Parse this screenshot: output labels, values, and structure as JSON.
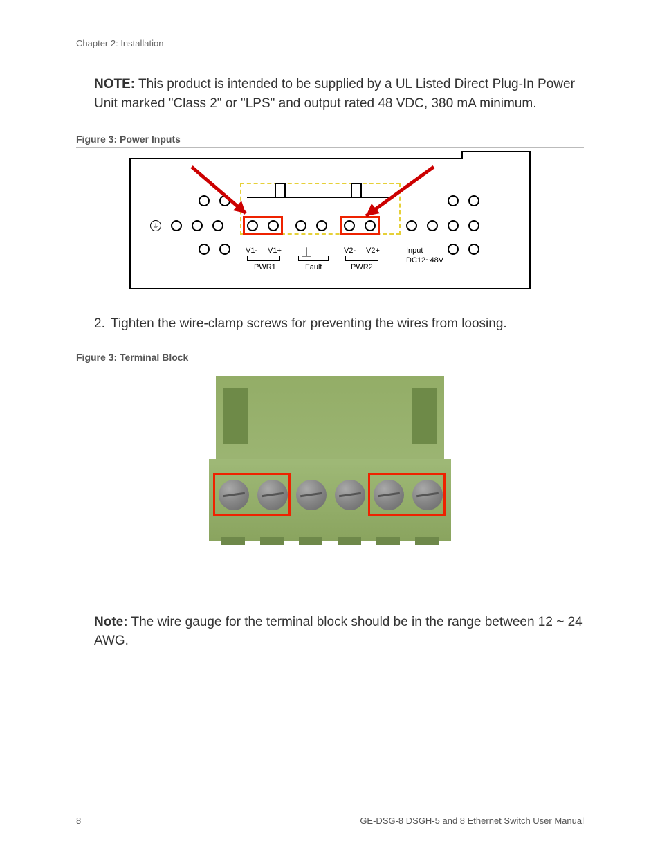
{
  "chapter_header": "Chapter 2: Installation",
  "note1_bold": "NOTE:",
  "note1_text": " This product is intended to be supplied by a UL Listed Direct Plug-In Power Unit marked \"Class 2\" or \"LPS\" and output rated 48 VDC, 380 mA minimum.",
  "figure3a_caption": "Figure 3: Power Inputs",
  "diagram1": {
    "v1_minus": "V1-",
    "v1_plus": "V1+",
    "v2_minus": "V2-",
    "v2_plus": "V2+",
    "input": "Input",
    "dc_range": "DC12~48V",
    "pwr1": "PWR1",
    "fault": "Fault",
    "pwr2": "PWR2",
    "ground_glyph": "⏚"
  },
  "step2_num": "2.",
  "step2_text": "Tighten the wire-clamp screws for preventing the wires from loosing.",
  "figure3b_caption": "Figure 3: Terminal Block",
  "note2_bold": "Note:",
  "note2_text": " The wire gauge for the terminal block should be in the range between 12 ~ 24 AWG.",
  "footer_page": "8",
  "footer_title": "GE-DSG-8 DSGH-5 and 8 Ethernet Switch User Manual"
}
